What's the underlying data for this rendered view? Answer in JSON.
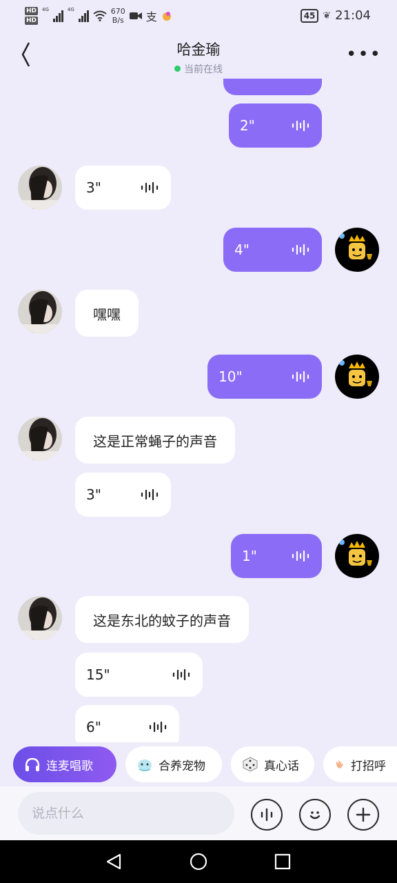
{
  "status_bar": {
    "hd1": "HD",
    "hd2": "HD",
    "net1": "4G",
    "net2": "4G",
    "speed_value": "670",
    "speed_unit": "B/s",
    "battery": "45",
    "time": "21:04"
  },
  "header": {
    "title": "哈金瑜",
    "status": "当前在线"
  },
  "messages": [
    {
      "side": "sent",
      "type": "voice",
      "text": "2\""
    },
    {
      "side": "recv",
      "type": "voice",
      "text": "3\""
    },
    {
      "side": "sent",
      "type": "voice",
      "text": "4\""
    },
    {
      "side": "recv",
      "type": "text",
      "text": "嘿嘿"
    },
    {
      "side": "sent",
      "type": "voice",
      "text": "10\""
    },
    {
      "side": "recv",
      "type": "text",
      "text": "这是正常蝇子的声音"
    },
    {
      "side": "recv",
      "type": "voice",
      "text": "3\""
    },
    {
      "side": "sent",
      "type": "voice",
      "text": "1\""
    },
    {
      "side": "recv",
      "type": "text",
      "text": "这是东北的蚊子的声音"
    },
    {
      "side": "recv",
      "type": "voice",
      "text": "15\""
    },
    {
      "side": "recv",
      "type": "voice",
      "text": "6\""
    }
  ],
  "quick_actions": [
    {
      "label": "连麦唱歌",
      "icon": "headphones-icon"
    },
    {
      "label": "合养宠物",
      "icon": "pet-icon"
    },
    {
      "label": "真心话",
      "icon": "dice-icon"
    },
    {
      "label": "打招呼",
      "icon": "wave-hand-icon"
    }
  ],
  "input": {
    "placeholder": "说点什么"
  },
  "colors": {
    "sent_bubble": "#8b6cf6",
    "received_bubble": "#ffffff",
    "background": "#eeecfb",
    "online_dot": "#2ccb6c"
  }
}
